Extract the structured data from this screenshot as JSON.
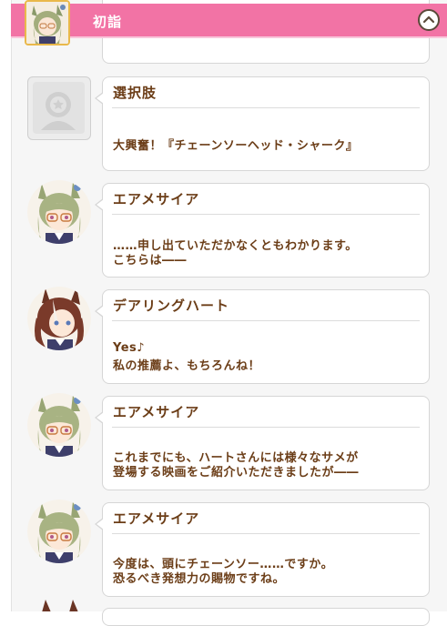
{
  "header": {
    "title": "初詣",
    "collapse_icon": "chevron-up-icon",
    "avatar_icon": "eishin-avatar-icon"
  },
  "messages": [
    {
      "speaker": "選択肢",
      "avatar": "placeholder-avatar-icon",
      "lines": [
        "大興奮！『チェーンソーヘッド・シャーク』"
      ]
    },
    {
      "speaker": "エアメサイア",
      "avatar": "air-messiah-avatar",
      "lines": [
        "……申し出ていただかなくともわかります。",
        "こちらは――"
      ]
    },
    {
      "speaker": "デアリングハート",
      "avatar": "daring-heart-avatar",
      "lines": [
        "Yes♪",
        "私の推薦よ、もちろんね！"
      ]
    },
    {
      "speaker": "エアメサイア",
      "avatar": "air-messiah-avatar",
      "lines": [
        "これまでにも、ハートさんには様々なサメが",
        "登場する映画をご紹介いただきましたが――"
      ]
    },
    {
      "speaker": "エアメサイア",
      "avatar": "air-messiah-avatar",
      "lines": [
        "今度は、頭にチェーンソー……ですか。",
        "恐るべき発想力の賜物ですね。"
      ]
    }
  ],
  "colors": {
    "header_pink": "#f273a5",
    "text_brown": "#6b3d17",
    "frame_gray": "#f6f6f6"
  }
}
